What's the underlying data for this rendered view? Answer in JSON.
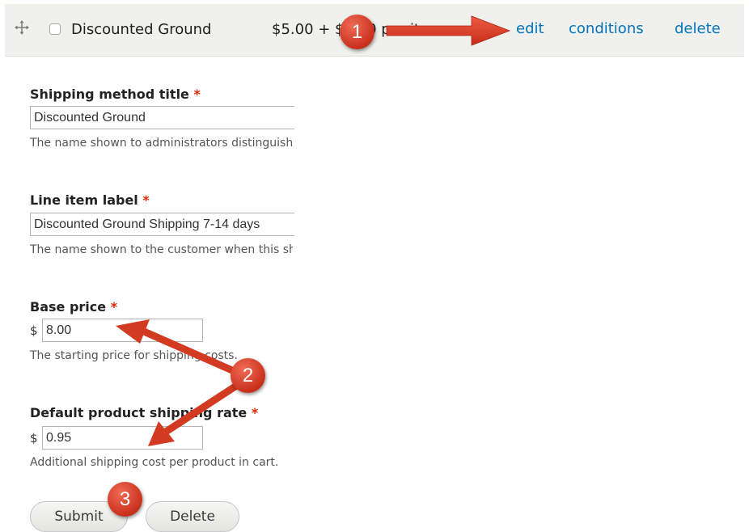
{
  "row": {
    "title": "Discounted Ground",
    "price_text": "$5.00 + $0.00 per item",
    "operations": [
      "edit",
      "conditions",
      "delete"
    ]
  },
  "form": {
    "shipping_method_title": {
      "label": "Shipping method title",
      "required_mark": "*",
      "value": "Discounted Ground",
      "description": "The name shown to administrators distinguishing this shipping method."
    },
    "line_item_label": {
      "label": "Line item label",
      "required_mark": "*",
      "value": "Discounted Ground Shipping 7-14 days",
      "description": "The name shown to the customer when this shipping method is selected."
    },
    "base_price": {
      "label": "Base price",
      "required_mark": "*",
      "currency": "$",
      "value": "8.00",
      "description": "The starting price for shipping costs."
    },
    "default_product_rate": {
      "label": "Default product shipping rate",
      "required_mark": "*",
      "currency": "$",
      "value": "0.95",
      "description": "Additional shipping cost per product in cart."
    }
  },
  "buttons": {
    "submit": "Submit",
    "delete": "Delete"
  },
  "markers": [
    "1",
    "2",
    "3"
  ],
  "colors": {
    "link": "#0074bd",
    "required": "#e32700",
    "marker": "#d83a24",
    "header_bg": "#f0f0ec"
  }
}
